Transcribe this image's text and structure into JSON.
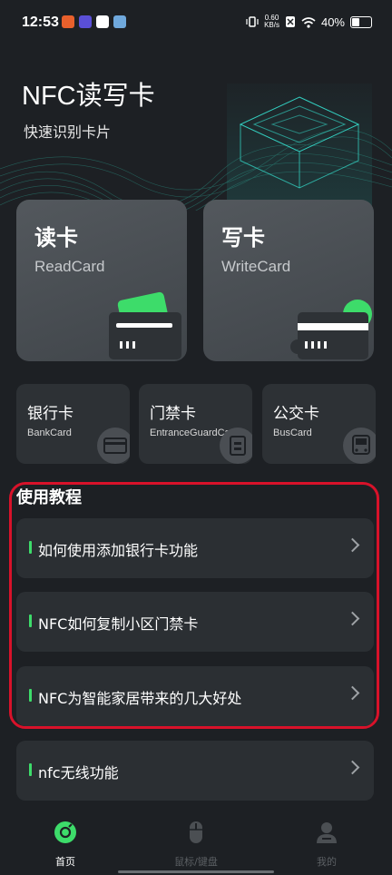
{
  "status": {
    "time": "12:53",
    "net_speed_value": "0.60",
    "net_speed_unit": "KB/s",
    "battery": "40%"
  },
  "hero": {
    "title": "NFC读写卡",
    "subtitle": "快速识别卡片"
  },
  "main_cards": [
    {
      "title": "读卡",
      "subtitle": "ReadCard"
    },
    {
      "title": "写卡",
      "subtitle": "WriteCard"
    }
  ],
  "small_cards": [
    {
      "title": "银行卡",
      "subtitle": "BankCard"
    },
    {
      "title": "门禁卡",
      "subtitle": "EntranceGuardCard"
    },
    {
      "title": "公交卡",
      "subtitle": "BusCard"
    }
  ],
  "tutorial": {
    "section_title": "使用教程",
    "items": [
      "如何使用添加银行卡功能",
      "NFC如何复制小区门禁卡",
      "NFC为智能家居带来的几大好处"
    ]
  },
  "extra_item": "nfc无线功能",
  "nav": [
    {
      "label": "首页",
      "icon": "home-icon"
    },
    {
      "label": "鼠标/键盘",
      "icon": "mouse-icon"
    },
    {
      "label": "我的",
      "icon": "profile-icon"
    }
  ],
  "colors": {
    "background": "#1d2024",
    "accent_green": "#3ddc6a",
    "highlight_red": "#d8122a",
    "hero_teal": "#2bd4c7"
  }
}
